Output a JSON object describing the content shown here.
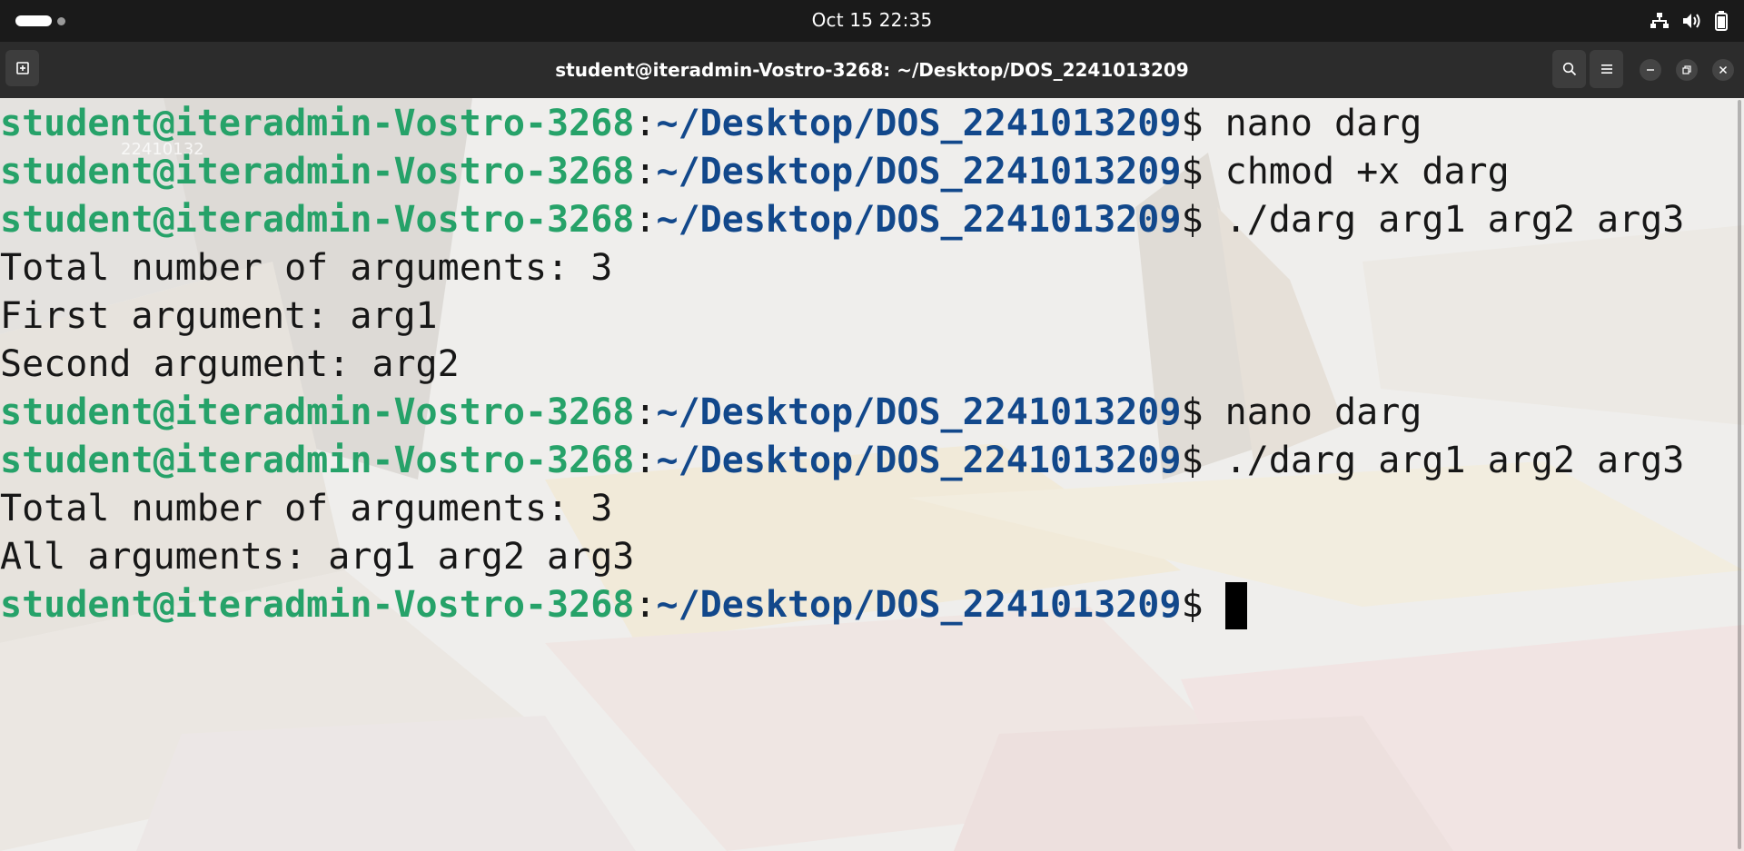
{
  "topbar": {
    "clock": "Oct 15  22:35",
    "icons": [
      "network-wired-icon",
      "volume-icon",
      "battery-icon"
    ]
  },
  "window": {
    "title": "student@iteradmin-Vostro-3268: ~/Desktop/DOS_2241013209",
    "buttons": [
      "new-tab-icon",
      "search-icon",
      "menu-icon",
      "minimize-icon",
      "restore-icon",
      "close-icon"
    ]
  },
  "terminal": {
    "watermark": "22410132",
    "prompt": {
      "user": "student@iteradmin-Vostro-3268",
      "colon": ":",
      "path": "~/Desktop/DOS_2241013209",
      "dollar": "$ "
    },
    "lines": [
      {
        "type": "cmd",
        "text": "nano darg"
      },
      {
        "type": "cmd",
        "text": "chmod +x darg"
      },
      {
        "type": "cmd",
        "text": "./darg arg1 arg2 arg3"
      },
      {
        "type": "out",
        "text": "Total number of arguments: 3"
      },
      {
        "type": "out",
        "text": "First argument: arg1"
      },
      {
        "type": "out",
        "text": "Second argument: arg2"
      },
      {
        "type": "cmd",
        "text": "nano darg"
      },
      {
        "type": "cmd",
        "text": "./darg arg1 arg2 arg3"
      },
      {
        "type": "out",
        "text": "Total number of arguments: 3"
      },
      {
        "type": "out",
        "text": "All arguments: arg1 arg2 arg3"
      },
      {
        "type": "cmd",
        "text": ""
      }
    ]
  },
  "colors": {
    "prompt_user": "#26a269",
    "prompt_path": "#12488b",
    "text": "#171717",
    "titlebar": "#2c2c2c",
    "topbar": "#1a1a1a"
  }
}
